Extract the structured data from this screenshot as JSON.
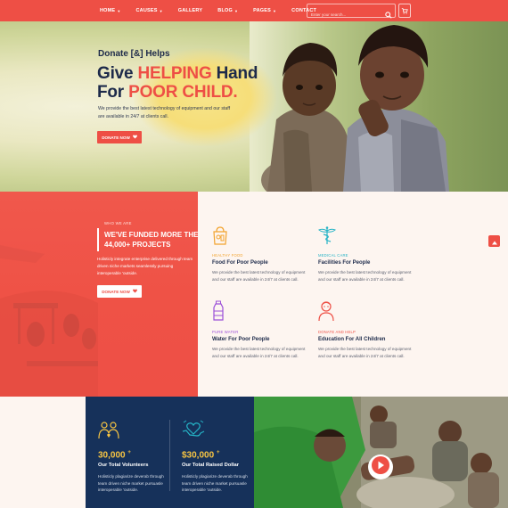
{
  "nav": {
    "items": [
      {
        "label": "HOME",
        "caret": true
      },
      {
        "label": "CAUSES",
        "caret": true
      },
      {
        "label": "GALLERY",
        "caret": false
      },
      {
        "label": "BLOG",
        "caret": true
      },
      {
        "label": "PAGES",
        "caret": true
      },
      {
        "label": "CONTACT",
        "caret": false
      }
    ],
    "search_placeholder": "Enter your search...",
    "icons": {
      "search": "search-icon",
      "cart": "cart-icon"
    }
  },
  "hero": {
    "subtitle": "Donate [&] Helps",
    "title_part1": "Give ",
    "title_highlight1": "HELPING",
    "title_part2": " Hand",
    "title_part3": "For ",
    "title_highlight2": "POOR CHILD.",
    "description": "We provide the best latest technology of equipment and our staff are available in 24/7 at clients call.",
    "button_label": "DONATE NOW"
  },
  "who": {
    "kicker": "WHO WE ARE",
    "heading_line1": "WE'VE FUNDED MORE THEN",
    "heading_line2": "44,000+ PROJECTS",
    "description": "Holisticly integrate enterprise delivered through team driven niche markets seamlessly pursuing interoperable 'outside.",
    "button_label": "DONATE NOW"
  },
  "services": [
    {
      "icon": "food-bag-icon",
      "kicker": "HEALTHY FOOD",
      "kicker_color": "#f2a32e",
      "title": "Food For Poor People",
      "description": "We provide the best latest technology of equipment and our staff are available in 24/7 at clients call."
    },
    {
      "icon": "caduceus-icon",
      "kicker": "MEDICAL CARE",
      "kicker_color": "#25b3c6",
      "title": "Facilities For People",
      "description": "We provide the best latest technology of equipment and our staff are available in 24/7 at clients call."
    },
    {
      "icon": "water-bottle-icon",
      "kicker": "PURE WATER",
      "kicker_color": "#9b4fd8",
      "title": "Water For Poor People",
      "description": "We provide the best latest technology of equipment and our staff are available in 24/7 at clients call."
    },
    {
      "icon": "child-icon",
      "kicker": "DONATE AND HELP",
      "kicker_color": "#ee4f45",
      "title": "Education For All Children",
      "description": "We provide the best latest technology of equipment and our staff are available in 24/7 at clients call."
    }
  ],
  "stats": [
    {
      "icon": "volunteers-icon",
      "number": "30,000",
      "suffix": "+",
      "title": "Our Total Volunteers",
      "description": "Holisticly plagiarize deverab through team driven niche market pursuasle interoperable 'outside."
    },
    {
      "icon": "donation-heart-icon",
      "number": "$30,000",
      "suffix": "+",
      "title": "Our Total Raised Dollar",
      "description": "Holisticly plagiarize deverab through team driven niche market pursuasle interoperable 'outside."
    }
  ],
  "colors": {
    "accent": "#ee4f45",
    "navy": "#16315a",
    "gold": "#f6c443",
    "cream": "#fdf5f0"
  }
}
